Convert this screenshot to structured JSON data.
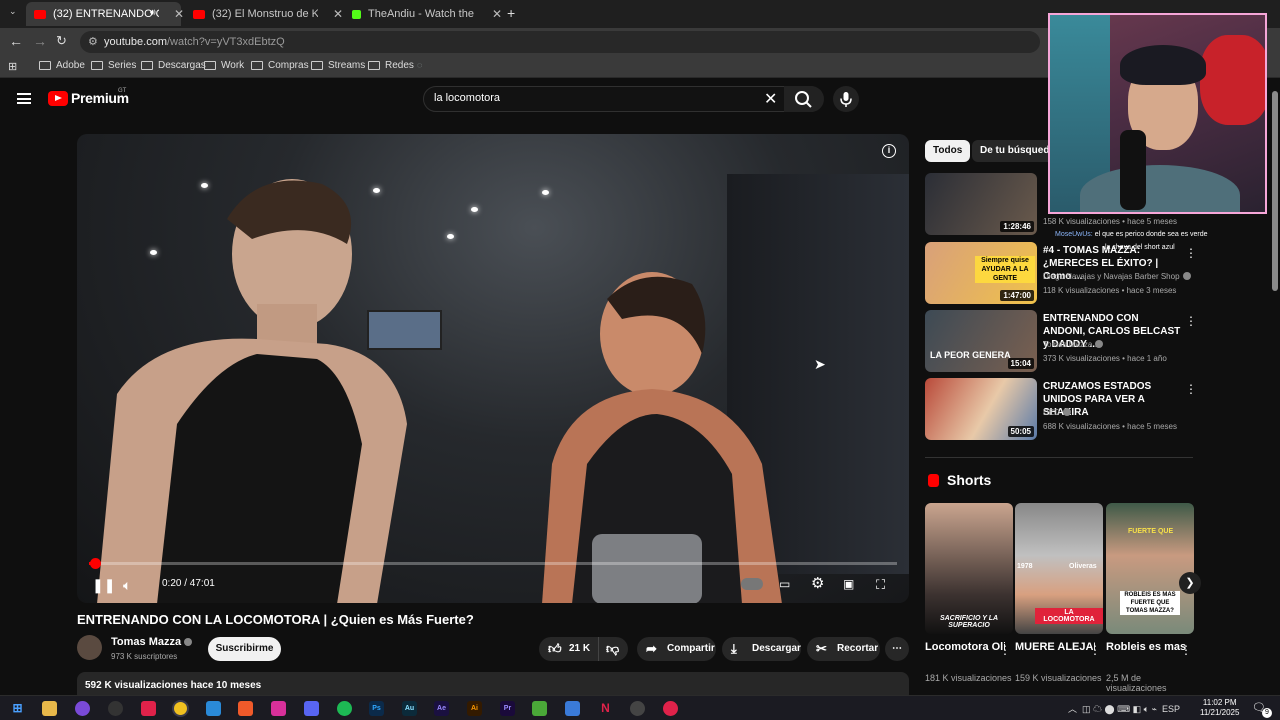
{
  "browser": {
    "tabs": [
      {
        "title": "(32) ENTRENANDO CON LA",
        "active": true
      },
      {
        "title": "(32) El Monstruo de Kičevo: un",
        "active": false
      },
      {
        "title": "TheAndiu - Watch the VOD on",
        "active": false
      }
    ],
    "new_tab": "+",
    "url_host": "youtube.com",
    "url_path": "/watch?v=yVT3xdEbtzQ",
    "bookmarks": [
      "Adobe",
      "Series",
      "Descargas",
      "Work",
      "Compras",
      "Streams",
      "Redes"
    ]
  },
  "header": {
    "brand": "Premium",
    "region": "GT",
    "search_value": "la locomotora"
  },
  "player": {
    "current_time": "0:20",
    "duration": "47:01",
    "time_display": "0:20 / 47:01",
    "progress_fraction": 0.007
  },
  "video": {
    "title": "ENTRENANDO CON LA LOCOMOTORA | ¿Quien es Más Fuerte?",
    "channel": "Tomas Mazza",
    "subscribers": "973 K suscriptores",
    "subscribe_label": "Suscribirme",
    "likes": "21 K",
    "share_label": "Compartir",
    "download_label": "Descargar",
    "clip_label": "Recortar",
    "views_date": "592 K visualizaciones  hace 10 meses"
  },
  "sidebar": {
    "chips": [
      "Todos",
      "De tu búsqueda"
    ],
    "recommendations": [
      {
        "title": "",
        "channel": "",
        "meta": "158 K visualizaciones • hace 5 meses",
        "duration": "1:28:46",
        "color": "#3b3f48"
      },
      {
        "title": "#4 - TOMAS MAZZA: ¿MERECES EL ÉXITO? | Como ...",
        "channel": "Diego Navajas y Navajas Barber Shop",
        "meta": "118 K visualizaciones • hace 3 meses",
        "duration": "1:47:00",
        "thumb_text": "Siempre quise AYUDAR A LA GENTE",
        "color": "#b97a4c"
      },
      {
        "title": "ENTRENANDO CON ANDONI, CARLOS BELCAST y DADDY ...",
        "channel": "Tomas Mazza",
        "meta": "373 K visualizaciones • hace 1 año",
        "duration": "15:04",
        "thumb_text": "LA PEOR GENERA",
        "color": "#4b5a66"
      },
      {
        "title": "CRUZAMOS ESTADOS UNIDOS PARA VER A SHAKIRA",
        "channel": "DED",
        "meta": "688 K visualizaciones • hace 5 meses",
        "duration": "50:05",
        "color": "#8a6a5a"
      }
    ],
    "shorts_heading": "Shorts",
    "shorts": [
      {
        "title": "Locomotora Oliveras : ...",
        "views": "181 K visualizaciones",
        "thumb_text": "SACRIFICIO Y LA SUPERACIO",
        "color": "#7a6c66"
      },
      {
        "title": "MUERE ALEJANDR...",
        "views": "159 K visualizaciones",
        "thumb_text": "LA LOCOMOTORA",
        "thumb_top": "Oliveras",
        "thumb_year": "1978",
        "color": "#6e6e6e"
      },
      {
        "title": "Robleis es mas fuerte ...",
        "views": "2,5 M de visualizaciones",
        "thumb_text": "ROBLEIS ES MAS FUERTE QUE TOMAS MAZZA?",
        "thumb_top": "FUERTE QUE",
        "color": "#4c6a55"
      }
    ]
  },
  "overlay": {
    "chat": [
      {
        "user": "MoseUwUs:",
        "text": "el que es perico donde sea es verde"
      },
      {
        "user": "",
        "text": "la chava del short azul"
      }
    ]
  },
  "taskbar": {
    "tray_lang": "ESP",
    "time": "11:02 PM",
    "date": "11/21/2025",
    "notif": "9",
    "apps": [
      "Ps",
      "Au",
      "Ae",
      "Ai",
      "Pr"
    ]
  },
  "colors": {
    "accent": "#ff0000",
    "bg": "#0f0f0f",
    "chip_active": "#f1f1f1"
  }
}
